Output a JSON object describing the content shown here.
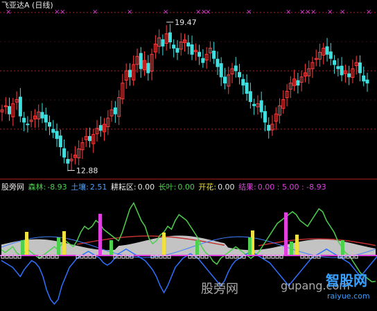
{
  "header": {
    "stock_title": "飞亚达A (日线)"
  },
  "indicator_row": {
    "name": "股旁网",
    "items": [
      {
        "label": "森林:",
        "value": "-8.93",
        "value_color": "#4dd04d"
      },
      {
        "label": "土壤:",
        "value": "2.51",
        "value_color": "#4aa0ff"
      },
      {
        "label": "耕耘区:",
        "value": "0.00",
        "value_color": "#e8e8e8"
      },
      {
        "label": "长叶:",
        "value": "0.00",
        "value_color": "#4dd04d"
      },
      {
        "label": "开花:",
        "value": "0.00",
        "value_color": "#f0e040"
      },
      {
        "label": "结果:",
        "value": "0.00 : 5.00 : -8.93",
        "value_color": "#e040e0"
      }
    ]
  },
  "watermarks": {
    "site_name": "股旁网",
    "site_url": "gupang.com",
    "brand": "智股网",
    "brand_url": "raiyue.com"
  },
  "colors": {
    "up": "#ff4040",
    "down": "#40e0e0",
    "green_line": "#4dd04d",
    "blue_line": "#3070ff",
    "yellow_bar": "#f0e040",
    "magenta_bar": "#e040e0",
    "grid": "#b02020"
  },
  "chart_data": [
    {
      "type": "candlestick",
      "title": "飞亚达A (日线)",
      "annotations": [
        {
          "text": "19.47",
          "kind": "high"
        },
        {
          "text": "12.88",
          "kind": "low"
        }
      ],
      "price_range": [
        12.5,
        20.2
      ],
      "closes": [
        15.6,
        15.8,
        15.4,
        15.9,
        16.1,
        15.3,
        15.0,
        14.9,
        15.1,
        15.3,
        15.5,
        15.2,
        15.0,
        14.8,
        14.5,
        14.2,
        13.8,
        13.3,
        13.0,
        13.2,
        13.4,
        13.7,
        14.0,
        14.3,
        14.1,
        14.4,
        14.7,
        14.6,
        14.9,
        15.2,
        15.6,
        15.4,
        16.2,
        16.9,
        17.5,
        17.2,
        17.8,
        18.2,
        17.6,
        18.0,
        17.4,
        18.3,
        18.8,
        19.1,
        18.7,
        19.3,
        18.9,
        18.6,
        18.4,
        18.9,
        19.0,
        18.7,
        18.3,
        18.5,
        18.2,
        17.9,
        18.3,
        18.6,
        18.1,
        17.7,
        17.2,
        16.9,
        17.3,
        17.6,
        17.5,
        17.2,
        16.8,
        16.4,
        16.0,
        15.8,
        15.9,
        15.5,
        15.0,
        14.6,
        14.9,
        15.4,
        15.8,
        16.1,
        16.5,
        16.9,
        17.1,
        16.8,
        17.2,
        17.4,
        17.6,
        17.9,
        18.1,
        18.4,
        18.6,
        18.3,
        18.1,
        17.8,
        17.6,
        17.3,
        17.5,
        17.2,
        17.6,
        17.9,
        17.4,
        17.0,
        16.9
      ]
    },
    {
      "type": "indicator",
      "series": [
        {
          "name": "森林",
          "color": "#4dd04d",
          "values": [
            2,
            1,
            2,
            3,
            1,
            0,
            1,
            2,
            1,
            0,
            -1,
            0,
            1,
            2,
            3,
            2,
            4,
            5,
            4,
            3,
            5,
            8,
            10,
            9,
            10,
            12,
            11,
            9,
            8,
            7,
            6,
            5,
            8,
            12,
            16,
            18,
            15,
            12,
            10,
            6,
            4,
            5,
            7,
            8,
            10,
            9,
            12,
            14,
            13,
            12,
            10,
            8,
            6,
            3,
            1,
            0,
            -2,
            -3,
            -1,
            0,
            1,
            2,
            3,
            2,
            1,
            0,
            -1,
            0,
            1,
            3,
            5,
            7,
            9,
            11,
            12,
            13,
            14,
            15,
            14,
            12,
            11,
            10,
            12,
            14,
            16,
            15,
            12,
            10,
            8,
            5,
            3,
            1,
            0,
            -2,
            -4,
            -6,
            -7,
            -8,
            -9,
            -8.9
          ]
        },
        {
          "name": "土壤",
          "color": "#4aa0ff",
          "values": [
            -1,
            -2,
            -3,
            -4,
            -6,
            -8,
            -5,
            -3,
            -1,
            -2,
            -4,
            -8,
            -14,
            -18,
            -20,
            -18,
            -12,
            -8,
            -4,
            -2,
            0,
            1,
            2,
            3,
            2,
            1,
            0,
            -2,
            -3,
            -2,
            0,
            2,
            3,
            4,
            3,
            2,
            1,
            0,
            -1,
            -3,
            -5,
            -8,
            -12,
            -15,
            -12,
            -8,
            -4,
            -2,
            0,
            1,
            2,
            1,
            0,
            -2,
            -4,
            -6,
            -8,
            -10,
            -12,
            -10,
            -6,
            -3,
            -1,
            0,
            1,
            2,
            3,
            2,
            1,
            0,
            -1,
            -2,
            -4,
            -6,
            -8,
            -10,
            -12,
            -10,
            -8,
            -6,
            -4,
            -2,
            0,
            1,
            2,
            3,
            4,
            3,
            2,
            1,
            0,
            -1,
            -2,
            -4,
            -6,
            -8,
            -6,
            -4,
            -2,
            0,
            2.5
          ]
        },
        {
          "name": "耕耘区",
          "color": "#e8e8e8",
          "values": [
            0
          ]
        },
        {
          "name": "长叶",
          "color": "#4dd04d",
          "values": [
            0
          ]
        },
        {
          "name": "开花",
          "color": "#f0e040",
          "values": [
            0
          ]
        },
        {
          "name": "结果",
          "color": "#e040e0",
          "values": [
            0,
            5,
            -8.93
          ]
        }
      ]
    }
  ]
}
